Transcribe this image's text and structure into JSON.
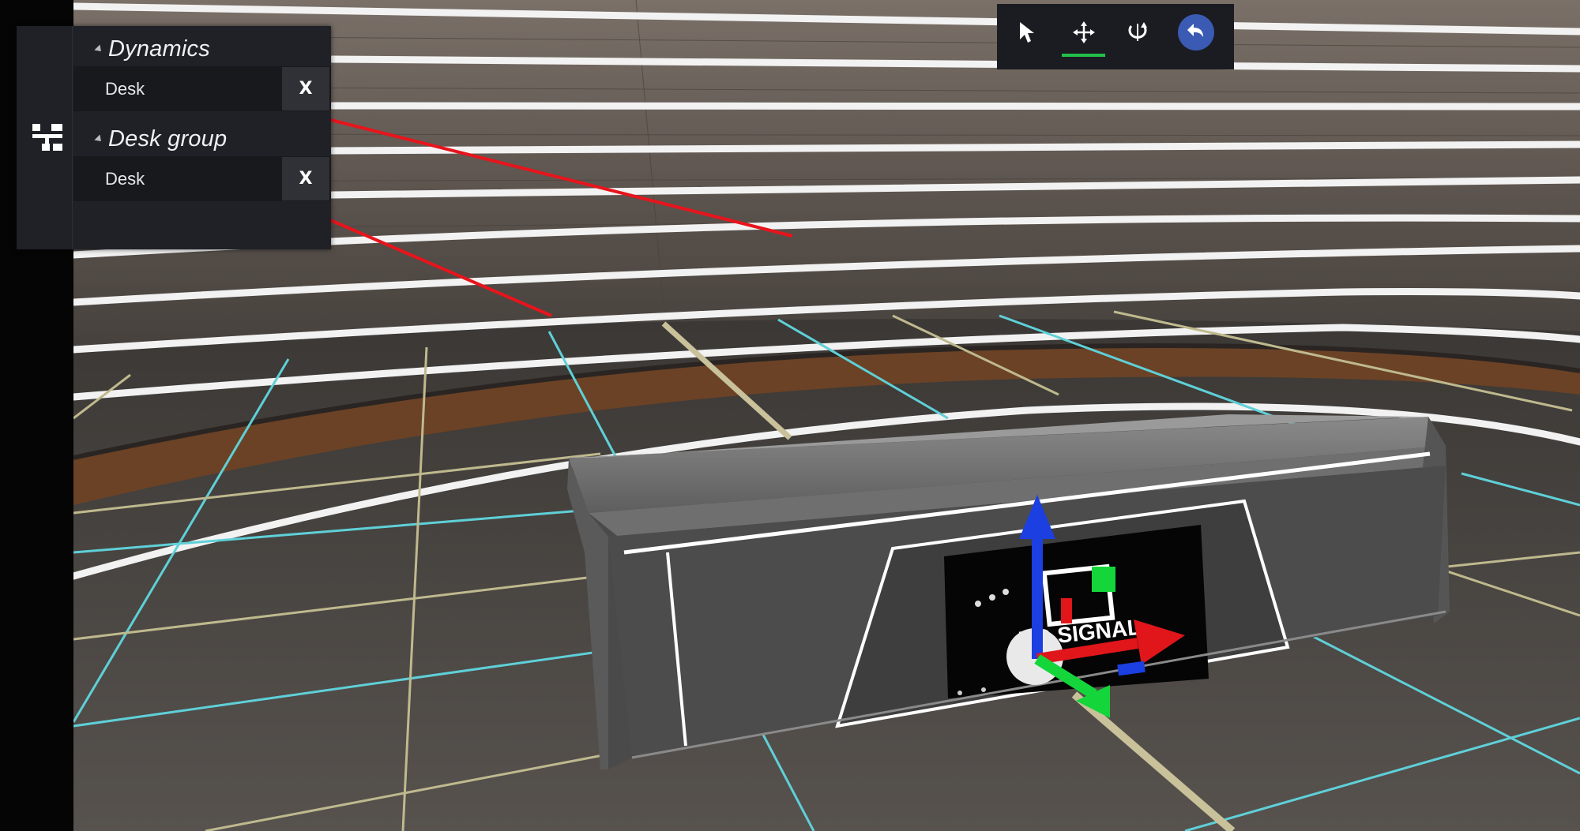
{
  "outliner": {
    "groups": [
      {
        "title": "Dynamics",
        "items": [
          {
            "label": "Desk",
            "remove_label": "X"
          }
        ]
      },
      {
        "title": "Desk group",
        "items": [
          {
            "label": "Desk",
            "remove_label": "X"
          }
        ]
      }
    ],
    "rail_icon": "hierarchy-icon"
  },
  "toolbar": {
    "tools": [
      {
        "name": "select",
        "icon": "cursor-icon",
        "active": false
      },
      {
        "name": "move",
        "icon": "move-arrows-icon",
        "active": true
      },
      {
        "name": "rotate",
        "icon": "rotate-icon",
        "active": false
      },
      {
        "name": "undo",
        "icon": "undo-icon",
        "active": false
      }
    ],
    "active_color": "#22c04a",
    "undo_color": "#3a5ab4"
  },
  "scene": {
    "screen_text": "NO SIGNAL",
    "gizmo_colors": {
      "x": "#e0161a",
      "y": "#1b3fe0",
      "z": "#14d63a"
    },
    "annotation_color": "#e8141c"
  }
}
